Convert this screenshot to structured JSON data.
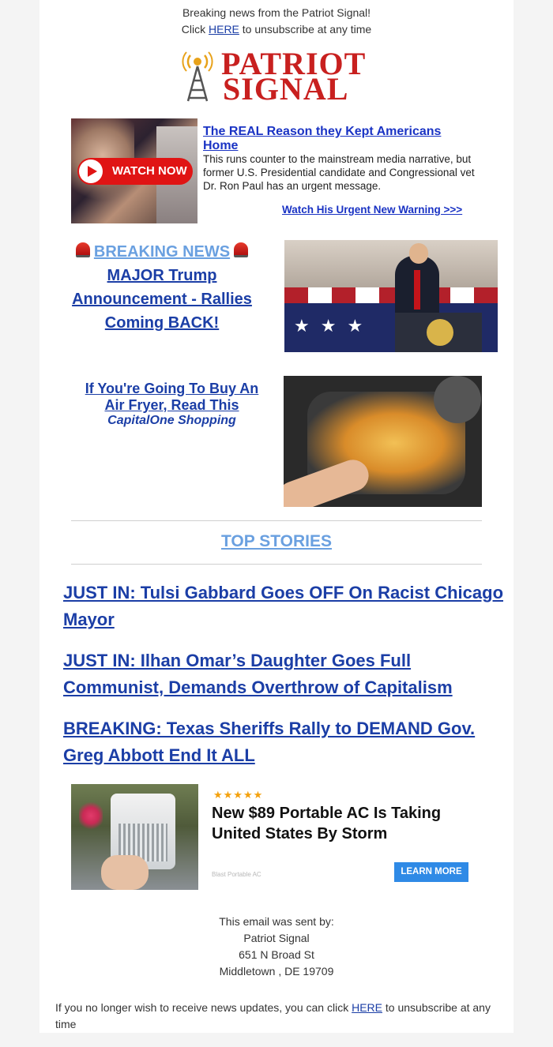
{
  "preheader": {
    "line1": "Breaking news from the Patriot Signal!",
    "line2_prefix": "Click ",
    "line2_link": "HERE",
    "line2_suffix": " to unsubscribe at any time"
  },
  "logo": {
    "line1": "PATRIOT",
    "line2": "SIGNAL",
    "icon": "radio-tower-icon",
    "color": "#c8201f"
  },
  "promo_ron_paul": {
    "watch_badge": "WATCH NOW",
    "title": "The REAL Reason they Kept Americans Home",
    "body": "This runs counter to the mainstream media narrative, but former U.S. Presidential candidate and Congressional vet Dr. Ron Paul has an urgent message.",
    "cta": "Watch His Urgent New Warning >>>"
  },
  "breaking": {
    "header": "BREAKING NEWS",
    "siren_icon": "siren-icon",
    "title": "MAJOR Trump Announcement - Rallies Coming BACK!"
  },
  "airfryer": {
    "title": "If You're Going To Buy An Air Fryer, Read This",
    "source": "CapitalOne Shopping"
  },
  "top_stories": {
    "header": "TOP STORIES",
    "items": [
      "JUST IN: Tulsi Gabbard Goes OFF On Racist Chicago Mayor",
      "JUST IN: Ilhan Omar’s Daughter Goes Full Communist, Demands Overthrow of Capitalism",
      "BREAKING: Texas Sheriffs Rally to DEMAND Gov. Greg Abbott End It ALL"
    ]
  },
  "ad_ac": {
    "stars": "★★★★★",
    "title": "New $89 Portable AC Is Taking United States By Storm",
    "brand": "Blast Portable AC",
    "cta": "LEARN MORE"
  },
  "footer": {
    "sent_by": "This email was sent by:",
    "org": "Patriot Signal",
    "street": "651 N Broad St",
    "city": "Middletown , DE 19709",
    "unsub_prefix": "If you no longer wish to receive news updates, you can click ",
    "unsub_link": "HERE",
    "unsub_suffix": " to unsubscribe at any time"
  },
  "colors": {
    "link": "#1b3ea6",
    "accent_blue": "#6aa0e0",
    "brand_red": "#c8201f",
    "cta_blue": "#2f8ae6"
  }
}
